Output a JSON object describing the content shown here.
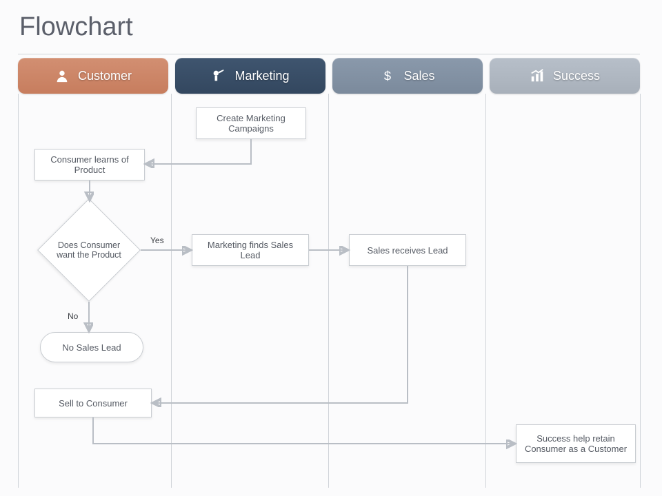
{
  "title": "Flowchart",
  "lanes": {
    "customer": {
      "label": "Customer",
      "icon": "person-icon",
      "color": "#c77d5e"
    },
    "marketing": {
      "label": "Marketing",
      "icon": "megaphone-icon",
      "color": "#33475f"
    },
    "sales": {
      "label": "Sales",
      "icon": "dollar-icon",
      "color": "#7b8a9c"
    },
    "success": {
      "label": "Success",
      "icon": "chart-icon",
      "color": "#a8b0ba"
    }
  },
  "nodes": {
    "create_campaigns": {
      "lane": "marketing",
      "label": "Create Marketing Campaigns"
    },
    "learn_product": {
      "lane": "customer",
      "label": "Consumer learns of Product"
    },
    "decision_want": {
      "lane": "customer",
      "label": "Does Consumer want the Product"
    },
    "find_lead": {
      "lane": "marketing",
      "label": "Marketing finds Sales Lead"
    },
    "receive_lead": {
      "lane": "sales",
      "label": "Sales receives Lead"
    },
    "no_lead": {
      "lane": "customer",
      "label": "No Sales Lead"
    },
    "sell": {
      "lane": "customer",
      "label": "Sell to Consumer"
    },
    "retain": {
      "lane": "success",
      "label": "Success help retain Consumer as a Customer"
    }
  },
  "edges": [
    {
      "from": "create_campaigns",
      "to": "learn_product"
    },
    {
      "from": "learn_product",
      "to": "decision_want"
    },
    {
      "from": "decision_want",
      "to": "find_lead",
      "label": "Yes"
    },
    {
      "from": "decision_want",
      "to": "no_lead",
      "label": "No"
    },
    {
      "from": "find_lead",
      "to": "receive_lead"
    },
    {
      "from": "receive_lead",
      "to": "sell"
    },
    {
      "from": "sell",
      "to": "retain"
    }
  ],
  "edge_labels": {
    "yes": "Yes",
    "no": "No"
  }
}
